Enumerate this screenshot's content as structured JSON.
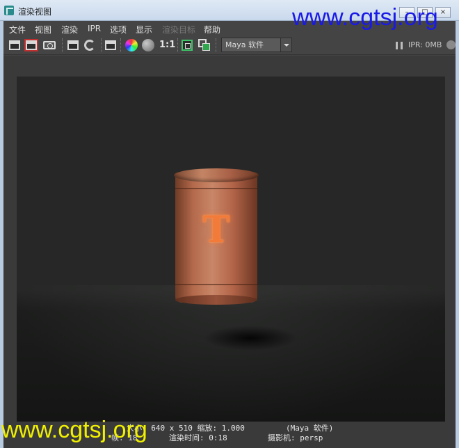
{
  "window": {
    "title": "渲染视图",
    "minimize": "–",
    "maximize": "□",
    "close": "×"
  },
  "watermark": {
    "top": "www.cgtsj.org",
    "bottom": "www.cgtsj.org"
  },
  "menu": [
    "文件",
    "视图",
    "渲染",
    "IPR",
    "选项",
    "显示",
    "渲染目标",
    "帮助"
  ],
  "toolbar": {
    "ratio_label": "1:1",
    "renderer": "Maya 软件",
    "ipr_memory": "IPR: 0MB"
  },
  "status": {
    "line1_left": "大小: 640 x 510  缩放: 1.000",
    "line1_right": "(Maya 软件)",
    "line2_left": "帧: 18",
    "line2_mid": "渲染时间: 0:18",
    "line2_right": "摄影机: persp"
  },
  "render": {
    "can_letter": "T"
  },
  "colors": {
    "background": "#444444",
    "render_bg": "#262726",
    "watermark_top": "#1a1ae6",
    "watermark_bottom": "#f0f000",
    "accent_green": "#3fc46a",
    "accent_red": "#c03030"
  }
}
